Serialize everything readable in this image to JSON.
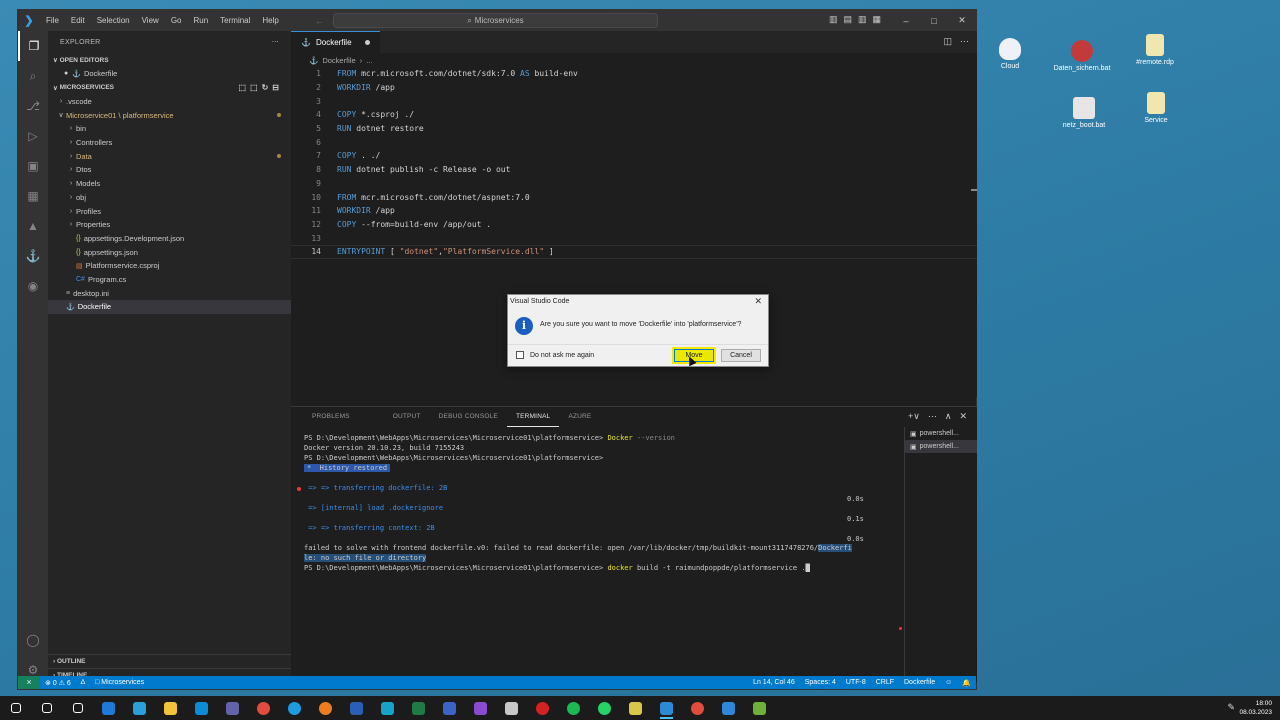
{
  "desktop": {
    "icons": [
      {
        "label": "Cloud",
        "color": "#e8eef5"
      },
      {
        "label": "Daten_sichern.bat",
        "color": "#c23b3b"
      },
      {
        "label": "#remote.rdp",
        "color": "#f0e6b0"
      },
      {
        "label": "netz_boot.bat",
        "color": "#e6e6e6"
      },
      {
        "label": "Service",
        "color": "#f0e6b0"
      }
    ]
  },
  "window": {
    "menu": [
      "File",
      "Edit",
      "Selection",
      "View",
      "Go",
      "Run",
      "Terminal",
      "Help"
    ],
    "search": "Microservices"
  },
  "sidebar": {
    "title": "EXPLORER",
    "open_editors_label": "OPEN EDITORS",
    "open_editor_file": "Dockerfile",
    "folder_label": "MICROSERVICES",
    "items": [
      {
        "label": ".vscode",
        "indent": 1,
        "type": "folder-closed"
      },
      {
        "label": "Microservice01 \\ platformservice",
        "indent": 1,
        "type": "folder-open",
        "modified": true
      },
      {
        "label": "bin",
        "indent": 2,
        "type": "folder-closed"
      },
      {
        "label": "Controllers",
        "indent": 2,
        "type": "folder-closed"
      },
      {
        "label": "Data",
        "indent": 2,
        "type": "folder-closed",
        "modified": true
      },
      {
        "label": "Dtos",
        "indent": 2,
        "type": "folder-closed"
      },
      {
        "label": "Models",
        "indent": 2,
        "type": "folder-closed"
      },
      {
        "label": "obj",
        "indent": 2,
        "type": "folder-closed"
      },
      {
        "label": "Profiles",
        "indent": 2,
        "type": "folder-closed"
      },
      {
        "label": "Properties",
        "indent": 2,
        "type": "folder-closed"
      },
      {
        "label": "appsettings.Development.json",
        "indent": 2,
        "type": "json"
      },
      {
        "label": "appsettings.json",
        "indent": 2,
        "type": "json"
      },
      {
        "label": "Platformservice.csproj",
        "indent": 2,
        "type": "xml"
      },
      {
        "label": "Program.cs",
        "indent": 2,
        "type": "cs"
      },
      {
        "label": "desktop.ini",
        "indent": 1,
        "type": "file"
      },
      {
        "label": "Dockerfile",
        "indent": 1,
        "type": "docker",
        "selected": true
      }
    ],
    "outline_label": "OUTLINE",
    "timeline_label": "TIMELINE"
  },
  "editor": {
    "tab_label": "Dockerfile",
    "breadcrumb": [
      "Dockerfile",
      "..."
    ],
    "lines": [
      {
        "n": "1",
        "parts": [
          [
            "kw",
            "FROM"
          ],
          [
            "tx",
            " mcr.microsoft.com/dotnet/sdk:7.0 "
          ],
          [
            "kw",
            "AS"
          ],
          [
            "tx",
            " build-env"
          ]
        ]
      },
      {
        "n": "2",
        "parts": [
          [
            "kw",
            "WORKDIR"
          ],
          [
            "tx",
            " /app"
          ]
        ]
      },
      {
        "n": "3",
        "parts": []
      },
      {
        "n": "4",
        "parts": [
          [
            "kw",
            "COPY"
          ],
          [
            "tx",
            " *.csproj ./"
          ]
        ]
      },
      {
        "n": "5",
        "parts": [
          [
            "kw",
            "RUN"
          ],
          [
            "tx",
            " dotnet restore"
          ]
        ]
      },
      {
        "n": "6",
        "parts": []
      },
      {
        "n": "7",
        "parts": [
          [
            "kw",
            "COPY"
          ],
          [
            "tx",
            " . ./"
          ]
        ]
      },
      {
        "n": "8",
        "parts": [
          [
            "kw",
            "RUN"
          ],
          [
            "tx",
            " dotnet publish -c Release -o out"
          ]
        ]
      },
      {
        "n": "9",
        "parts": []
      },
      {
        "n": "10",
        "parts": [
          [
            "kw",
            "FROM"
          ],
          [
            "tx",
            " mcr.microsoft.com/dotnet/aspnet:7.0"
          ]
        ]
      },
      {
        "n": "11",
        "parts": [
          [
            "kw",
            "WORKDIR"
          ],
          [
            "tx",
            " /app"
          ]
        ]
      },
      {
        "n": "12",
        "parts": [
          [
            "kw",
            "COPY"
          ],
          [
            "tx",
            " --from=build-env /app/out ."
          ]
        ]
      },
      {
        "n": "13",
        "parts": []
      },
      {
        "n": "14",
        "parts": [
          [
            "kw",
            "ENTRYPOINT"
          ],
          [
            "tx",
            " [ "
          ],
          [
            "st",
            "\"dotnet\""
          ],
          [
            "tx",
            ","
          ],
          [
            "st",
            "\"PlatformService.dll\""
          ],
          [
            "tx",
            " ]"
          ]
        ],
        "current": true
      }
    ]
  },
  "dialog": {
    "title": "Visual Studio Code",
    "message": "Are you sure you want to move 'Dockerfile' into 'platformservice'?",
    "checkbox_label": "Do not ask me again",
    "primary": "Move",
    "secondary": "Cancel"
  },
  "panel": {
    "tabs": [
      "PROBLEMS",
      "OUTPUT",
      "DEBUG CONSOLE",
      "TERMINAL",
      "AZURE"
    ],
    "active_tab": "TERMINAL",
    "terminals": [
      "powershell...",
      "powershell..."
    ],
    "terminal": {
      "l1_prompt": "PS D:\\Development\\WebApps\\Microservices\\Microservice01\\platformservice>",
      "l1_cmd": "Docker",
      "l1_arg": "--version",
      "l2": "Docker version 20.10.23, build 7155243",
      "l3_prompt": "PS D:\\Development\\WebApps\\Microservices\\Microservice01\\platformservice>",
      "l4": "*  History restored",
      "l5": " => => transferring dockerfile: 2B",
      "l6": " => [internal] load .dockerignore",
      "l7": " => => transferring context: 2B",
      "l8a": "failed to solve with frontend dockerfile.v0: failed to read dockerfile: open /var/lib/docker/tmp/buildkit-mount3117478276/",
      "l8b": "Dockerfi",
      "l9": "le: no such file or directory",
      "l10_prompt": "PS D:\\Development\\WebApps\\Microservices\\Microservice01\\platformservice>",
      "l10_cmd": "docker",
      "l10_arg": "build -t raimundpoppde/platformservice .",
      "t1": "0.0s",
      "t2": "0.1s",
      "t3": "0.0s"
    }
  },
  "statusbar": {
    "errors": "0",
    "warnings": "6",
    "folder": "Microservices",
    "position": "Ln 14, Col 46",
    "spaces": "Spaces: 4",
    "encoding": "UTF-8",
    "eol": "CRLF",
    "language": "Dockerfile"
  },
  "taskbar": {
    "icons": [
      {
        "name": "start-icon",
        "color": "#ffffff"
      },
      {
        "name": "search-icon",
        "color": "#ffffff"
      },
      {
        "name": "task-view-icon",
        "color": "#ffffff"
      },
      {
        "name": "app-blue-icon",
        "color": "#1f7ad6"
      },
      {
        "name": "app-teal-icon",
        "color": "#2d9fd8"
      },
      {
        "name": "folder-icon",
        "color": "#f3c33b"
      },
      {
        "name": "store-icon",
        "color": "#0d8bd6"
      },
      {
        "name": "teams-icon",
        "color": "#6264a7"
      },
      {
        "name": "chrome-icon",
        "color": "#e24c3d"
      },
      {
        "name": "edge-icon",
        "color": "#1f9be0"
      },
      {
        "name": "firefox-icon",
        "color": "#ef7d1f"
      },
      {
        "name": "word-icon",
        "color": "#2b5fb6"
      },
      {
        "name": "webex-icon",
        "color": "#17a2c7"
      },
      {
        "name": "excel-icon",
        "color": "#1f7a45"
      },
      {
        "name": "azure-icon",
        "color": "#3d63c7"
      },
      {
        "name": "visual-studio-icon",
        "color": "#8a4bd1"
      },
      {
        "name": "tool-icon",
        "color": "#c8c8c8"
      },
      {
        "name": "record-icon",
        "color": "#d42121"
      },
      {
        "name": "spotify-icon",
        "color": "#1db954"
      },
      {
        "name": "whatsapp-icon",
        "color": "#25d366"
      },
      {
        "name": "notepad-icon",
        "color": "#d8c84a"
      },
      {
        "name": "vscode-icon",
        "color": "#2a8ad6",
        "active": true
      },
      {
        "name": "chrome2-icon",
        "color": "#e24c3d"
      },
      {
        "name": "app-cloud-icon",
        "color": "#2e87d8"
      },
      {
        "name": "app-green-icon",
        "color": "#6fb03a"
      }
    ],
    "time": "18:00",
    "date": "08.03.2023"
  }
}
